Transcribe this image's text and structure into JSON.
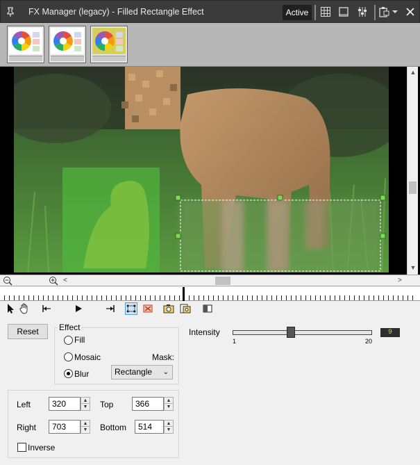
{
  "window": {
    "title": "FX Manager (legacy) - Filled Rectangle Effect",
    "status_button": "Active"
  },
  "icons": {
    "pin": "pin-icon",
    "grid": "grid-icon",
    "frame": "frame-icon",
    "sliders": "sliders-icon",
    "clipboard": "clipboard-icon",
    "dropdown": "chevron-down-icon",
    "close": "close-icon"
  },
  "thumbnails": [
    {
      "name": "effect-thumbnail-1",
      "selected": false
    },
    {
      "name": "effect-thumbnail-2",
      "selected": false
    },
    {
      "name": "effect-thumbnail-3",
      "selected": true
    }
  ],
  "toolbar": {
    "tools": [
      "select-arrow",
      "hand-pan",
      "go-to-start",
      "play",
      "go-to-end",
      "rectangle-tool",
      "filled-rect-tool",
      "snapshot",
      "copy-frame",
      "compare"
    ]
  },
  "settings": {
    "reset_label": "Reset",
    "effect_label": "Effect",
    "options": [
      "Fill",
      "Mosaic",
      "Blur"
    ],
    "selected_option": "Blur",
    "mask_label": "Mask:",
    "mask_value": "Rectangle",
    "intensity_label": "Intensity",
    "intensity_min": "1",
    "intensity_max": "20",
    "intensity_value": "9",
    "left_label": "Left",
    "left_value": "320",
    "top_label": "Top",
    "top_value": "366",
    "right_label": "Right",
    "right_value": "703",
    "bottom_label": "Bottom",
    "bottom_value": "514",
    "inverse_label": "Inverse"
  },
  "colors": {
    "titlebar": "#3b3b3b",
    "selection": "#5b9bd5",
    "slider_value": "#a8d86b",
    "mask_green": "#4fb43c"
  }
}
